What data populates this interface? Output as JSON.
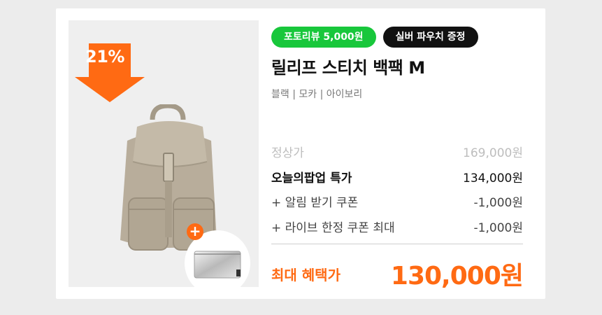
{
  "product": {
    "discount_rate": "21%",
    "badges": {
      "photo_review": "포토리뷰 5,000원",
      "gift": "실버 파우치 증정"
    },
    "name": "릴리프 스티치 백팩 M",
    "colors": "블랙 | 모카 | 아이보리",
    "images": {
      "main": "backpack-icon",
      "gift": "silver-pouch-icon"
    }
  },
  "pricing": {
    "regular_label": "정상가",
    "regular_value": "169,000원",
    "special_label": "오늘의팝업 특가",
    "special_value": "134,000원",
    "coupon1_label": "+ 알림 받기 쿠폰",
    "coupon1_value": "-1,000원",
    "coupon2_label": "+ 라이브 한정 쿠폰 최대",
    "coupon2_value": "-1,000원",
    "max_label": "최대 혜택가",
    "max_value": "130,000원"
  },
  "colors": {
    "accent": "#ff6a13",
    "badge_green": "#18c73b",
    "badge_black": "#111111"
  }
}
